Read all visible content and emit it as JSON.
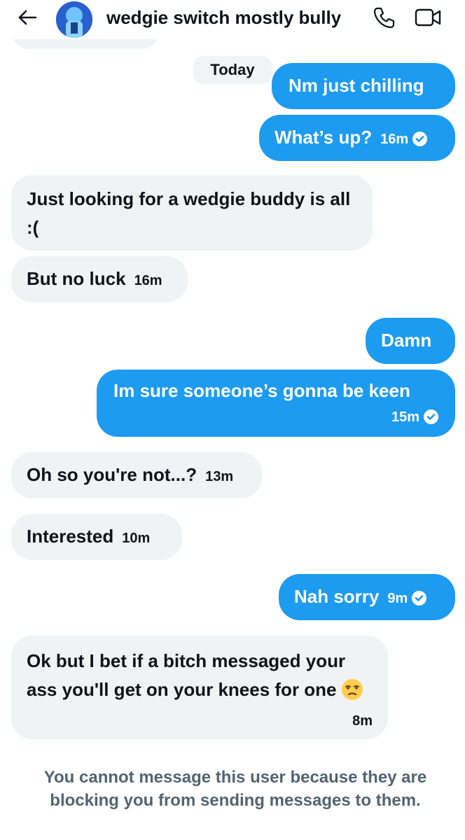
{
  "header": {
    "title": "wedgie switch mostly bully"
  },
  "date_separator": "Today",
  "messages": [
    {
      "side": "sent",
      "text": "Nm just chilling"
    },
    {
      "side": "sent",
      "text": "What’s up?",
      "time": "16m",
      "status": "seen"
    },
    {
      "side": "received",
      "text": "Just looking for a wedgie buddy is all :("
    },
    {
      "side": "received",
      "text": "But no luck",
      "time": "16m"
    },
    {
      "side": "sent",
      "text": "Damn"
    },
    {
      "side": "sent",
      "text": "Im sure someone’s gonna be keen",
      "time": "15m",
      "status": "seen"
    },
    {
      "side": "received",
      "text": "Oh so you're not...?",
      "time": "13m"
    },
    {
      "side": "received",
      "text": "Interested",
      "time": "10m"
    },
    {
      "side": "sent",
      "text": "Nah sorry",
      "time": "9m",
      "status": "seen"
    },
    {
      "side": "received",
      "text": "Ok but I bet if a bitch messaged your ass you'll get on your knees for one",
      "emoji": "unamused-face",
      "time": "8m"
    }
  ],
  "footer": {
    "notice": "You cannot message this user because they are blocking you from sending messages to them."
  },
  "colors": {
    "accent": "#1d9bf0",
    "received_bubble": "#eff3f4",
    "text": "#0f1419",
    "muted_text": "#536471"
  },
  "icons": [
    "back-arrow-icon",
    "phone-icon",
    "video-call-icon",
    "read-check-icon",
    "unamused-emoji-icon"
  ]
}
